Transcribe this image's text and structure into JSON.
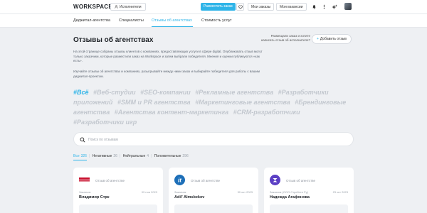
{
  "header": {
    "logo": "WORKSPACE",
    "role": "Исполнители",
    "post_order": "Разместить заказ",
    "my_orders": "Мои заказы",
    "my_vacancies": "Мои вакансии"
  },
  "nav": {
    "items": [
      {
        "label": "Диджитал-агентства"
      },
      {
        "label": "Специалисты"
      },
      {
        "label": "Отзывы об агентствах"
      },
      {
        "label": "Стоимость услуг"
      }
    ]
  },
  "main": {
    "title": "Отзывы об агентствах",
    "cta_note": "Размещали заказ и хотите написать отзыв об исполнителе?",
    "cta_button": "Добавить отзыв",
    "intro": "На этой странице собраны отзывы клиентов о компаниях, предоставляющих услуги в сфере digital. Опубликовать отзыв могут только заказчики, которые разместили заказ на Workspace и затем выбрали победителя. Мнения и оценки публикуются «как есть».",
    "intro2": "Изучайте отзывы об агентствах и компаниях, разыгрывайте между ними заказ и выбирайте победителя для работы с вашим диджитал-проектом.",
    "tags": [
      {
        "label": "#Всё",
        "active": true
      },
      {
        "label": "#Веб-студии"
      },
      {
        "label": "#SEO-компании"
      },
      {
        "label": "#Рекламные агентства"
      },
      {
        "label": "#Разработчики приложений"
      },
      {
        "label": "#SMM и PR агентства"
      },
      {
        "label": "#Маркетинговые агентства"
      },
      {
        "label": "#Брендинговые агентства"
      },
      {
        "label": "#Агентства контент-маркетинга"
      },
      {
        "label": "#CRM-разработчики"
      },
      {
        "label": "#Разработчики игр"
      }
    ],
    "search_placeholder": "Поиск по отзывам",
    "filters": [
      {
        "label": "Все",
        "count": "326",
        "active": true
      },
      {
        "label": "Негативные",
        "count": "26"
      },
      {
        "label": "Нейтральные",
        "count": "4"
      },
      {
        "label": "Положительные",
        "count": "296"
      }
    ],
    "filter_separator": "|"
  },
  "cards": [
    {
      "label": "Отзыв об агентстве",
      "customer": "Заказчик",
      "date": "09 ноя 2023",
      "name": "Владимир Стрк"
    },
    {
      "label": "Отзыв об агентстве",
      "customer": "Заказчик",
      "date": "30 окт 2023",
      "name": "Adil' Almsbekov"
    },
    {
      "label": "Отзыв об агентстве",
      "customer": "Заказчик (ООО Стрейтен Ру)",
      "date": "23 окт 2023",
      "name": "Надежда Агафонова"
    }
  ],
  "colors": {
    "accent": "#2fb4e8",
    "background": "#eef0f3"
  }
}
